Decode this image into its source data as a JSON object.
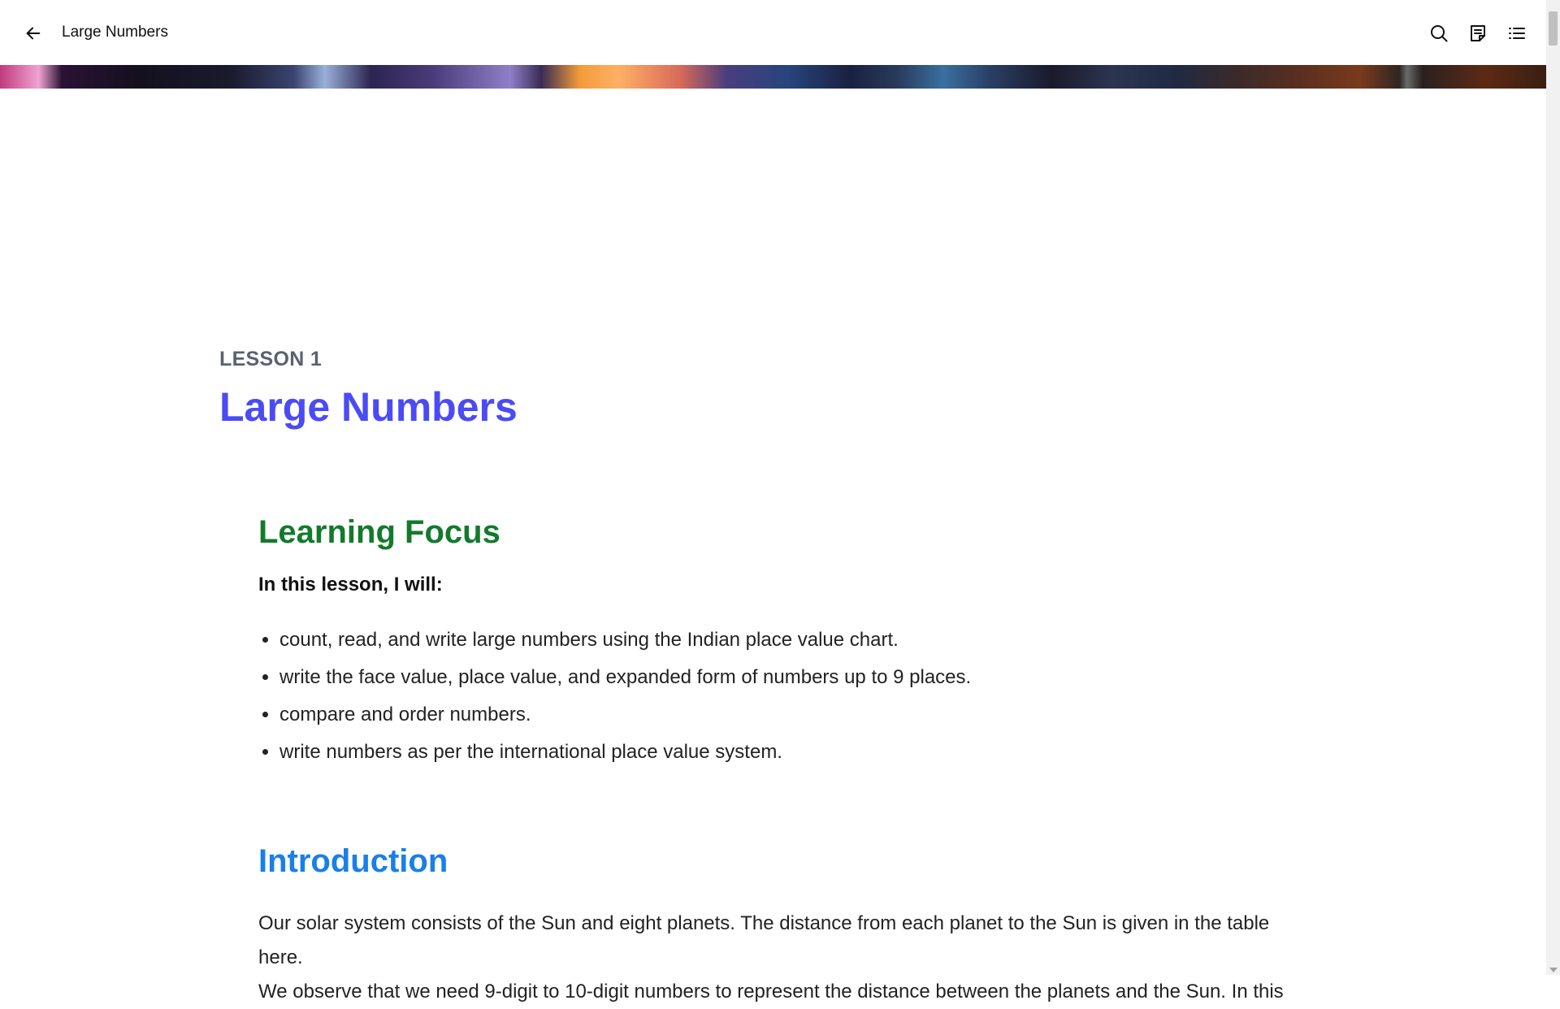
{
  "header": {
    "back_icon": "arrow-left-icon",
    "title": "Large Numbers",
    "tools": [
      {
        "icon": "search-icon"
      },
      {
        "icon": "notes-icon"
      },
      {
        "icon": "table-of-contents-icon"
      }
    ]
  },
  "lesson": {
    "label": "LESSON 1",
    "title": "Large Numbers"
  },
  "learning_focus": {
    "heading": "Learning Focus",
    "intro": "In this lesson, I will:",
    "items": [
      "count, read, and write large numbers using the Indian place value chart.",
      "write the face value, place value, and expanded form of numbers up to 9 places.",
      "compare and order numbers.",
      "write numbers as per the international place value system."
    ]
  },
  "introduction": {
    "heading": "Introduction",
    "lines": [
      "Our solar system consists of the Sun and eight planets. The distance from each planet to the Sun is given in the table here.",
      "We observe that we need 9-digit to 10-digit numbers to represent the distance between the planets and the Sun. In this"
    ]
  },
  "colors": {
    "lesson_title": "#4b4bf5",
    "focus_heading": "#137a2c",
    "intro_heading": "#1a7fe8",
    "lesson_label": "#5a6270"
  }
}
